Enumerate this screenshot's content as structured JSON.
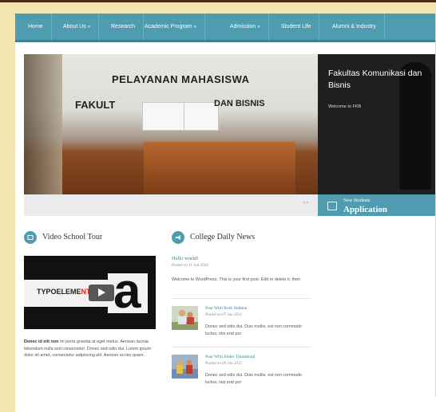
{
  "nav": {
    "items": [
      {
        "label": "Home",
        "arrow": ""
      },
      {
        "label": "About Us",
        "arrow": "»"
      },
      {
        "label": "Research",
        "arrow": ""
      },
      {
        "label": "Academic Program",
        "arrow": "»"
      },
      {
        "label": "Admission",
        "arrow": "»"
      },
      {
        "label": "Student Life",
        "arrow": ""
      },
      {
        "label": "Alumni & Industry",
        "arrow": ""
      }
    ]
  },
  "slider": {
    "photo_sign_top": "PELAYANAN MAHASISWA",
    "photo_sign_left": "FAKULT",
    "photo_sign_right": "DAN BISNIS",
    "title": "Fakultas Komunikasi dan Bisnis",
    "subtitle": "Welcome to FKB",
    "controls": "‹ ›",
    "tab": {
      "line1": "New Students",
      "line2": "Application",
      "icon": "calendar-icon"
    }
  },
  "video_section": {
    "heading": "Video School Tour",
    "icon": "video-icon",
    "video_brand_a": "TYPOELEME",
    "video_brand_b": "NT",
    "video_letter": "a",
    "description_bold": "Donec id elit non",
    "description_rest": " mi porta gravida at eget metus. Aenean lacinia bibendum nulla sed consectetur. Donec sed odio dui. Lorem ipsum dolor sit amet, consectetur adipiscing elit. Aenean eu leo quam."
  },
  "news_section": {
    "heading": "College Daily News",
    "icon": "megaphone-icon",
    "posts": [
      {
        "title": "Hello world!",
        "date": "Posted on 11 Jan 2016",
        "excerpt": "Welcome to WordPress. This is your first post. Edit or delete it, then"
      },
      {
        "title": "Post With Both Sidebar",
        "date": "Posted on 07 Jan 2012",
        "excerpt": "Donec sed odio dui. Duis mollis, est non commodo luctus, nisi erat por"
      },
      {
        "title": "Post With Slider Thumbnail",
        "date": "Posted on 06 Jan 2012",
        "excerpt": "Donec sed odio dui. Duis mollis, est non commodo luctus, nisi erat por"
      }
    ]
  },
  "colors": {
    "accent": "#4f9cb0",
    "background": "#f3e5b0",
    "link": "#2f7f96"
  }
}
